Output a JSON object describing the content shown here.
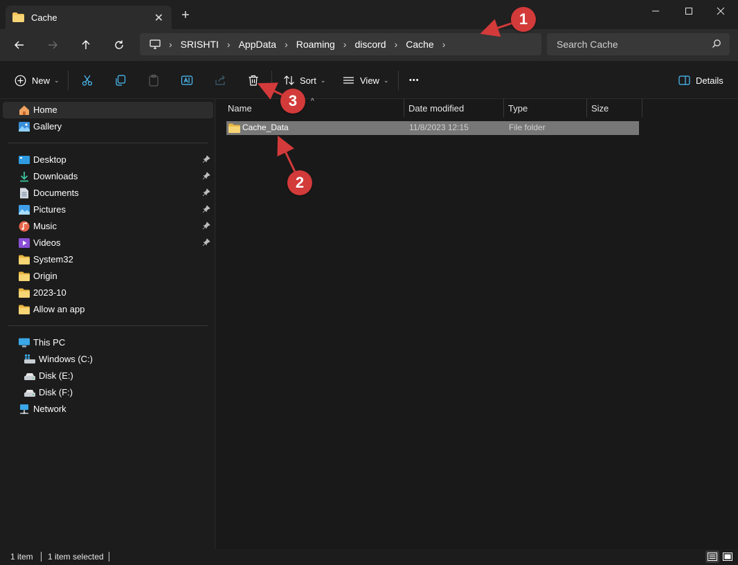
{
  "window": {
    "tab_title": "Cache",
    "new_tab": "+",
    "close_tab": "✕"
  },
  "nav": {
    "breadcrumbs": [
      "SRISHTI",
      "AppData",
      "Roaming",
      "discord",
      "Cache"
    ],
    "search_placeholder": "Search Cache"
  },
  "toolbar": {
    "new_label": "New",
    "sort_label": "Sort",
    "view_label": "View",
    "more_label": "•••",
    "details_label": "Details"
  },
  "sidebar": {
    "home": "Home",
    "gallery": "Gallery",
    "quick_access": [
      {
        "label": "Desktop",
        "icon": "desktop-icon"
      },
      {
        "label": "Downloads",
        "icon": "downloads-icon"
      },
      {
        "label": "Documents",
        "icon": "documents-icon"
      },
      {
        "label": "Pictures",
        "icon": "pictures-icon"
      },
      {
        "label": "Music",
        "icon": "music-icon"
      },
      {
        "label": "Videos",
        "icon": "videos-icon"
      }
    ],
    "folders": [
      "System32",
      "Origin",
      "2023-10",
      "Allow an app"
    ],
    "this_pc": "This PC",
    "drives": [
      "Windows (C:)",
      "Disk (E:)",
      "Disk (F:)"
    ],
    "network": "Network"
  },
  "table": {
    "columns": [
      "Name",
      "Date modified",
      "Type",
      "Size"
    ],
    "rows": [
      {
        "name": "Cache_Data",
        "date": "11/8/2023 12:15",
        "type": "File folder",
        "size": ""
      }
    ]
  },
  "status": {
    "count": "1 item",
    "selected": "1 item selected"
  },
  "annotations": {
    "one": "1",
    "two": "2",
    "three": "3",
    "color": "#d33a3a"
  },
  "colors": {
    "folder": "#f2c55c",
    "accent": "#4cc2ff",
    "selection": "#777777"
  }
}
